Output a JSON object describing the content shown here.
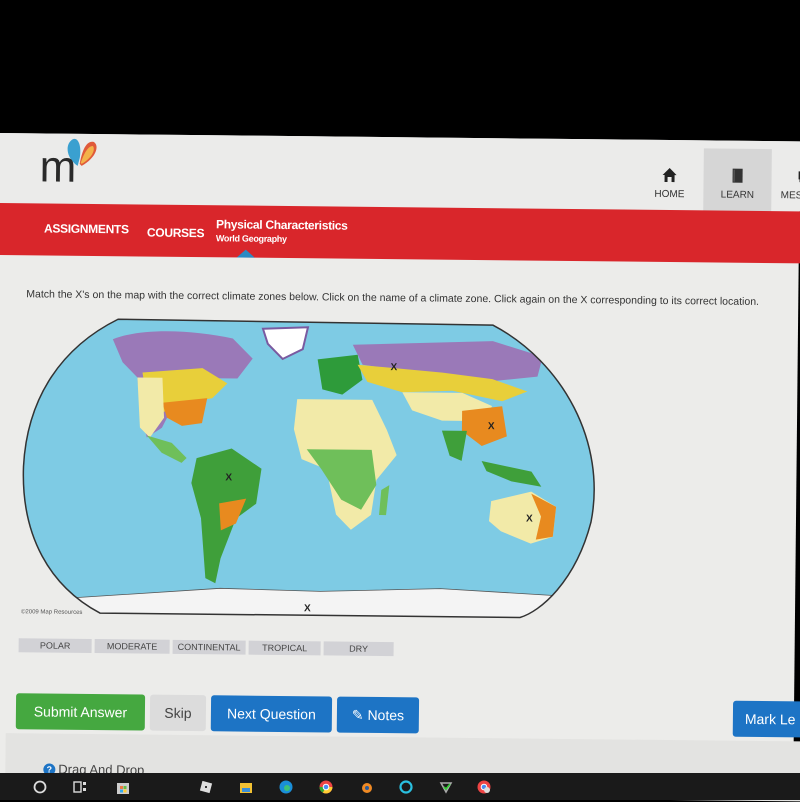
{
  "header": {
    "logo_letter": "m",
    "nav": [
      {
        "label": "HOME",
        "icon": "home-icon",
        "active": false
      },
      {
        "label": "LEARN",
        "icon": "book-icon",
        "active": true
      },
      {
        "label": "MESSAGE",
        "icon": "message-icon",
        "active": false
      }
    ]
  },
  "redbar": {
    "assignments": "ASSIGNMENTS",
    "courses": "COURSES",
    "course_title": "Physical Characteristics",
    "course_subtitle": "World Geography"
  },
  "question": {
    "instructions": "Match the X's on the map with the correct climate zones below. Click on the name of a climate zone. Click again on the X corresponding to its correct location.",
    "map_copyright": "©2009 Map Resources",
    "markers": [
      {
        "region": "Northern Russia",
        "label": "X"
      },
      {
        "region": "Eastern China",
        "label": "X"
      },
      {
        "region": "Amazon Basin",
        "label": "X"
      },
      {
        "region": "Australia interior",
        "label": "X"
      },
      {
        "region": "Antarctica",
        "label": "X"
      }
    ],
    "climate_zones": [
      "POLAR",
      "MODERATE",
      "CONTINENTAL",
      "TROPICAL",
      "DRY"
    ]
  },
  "actions": {
    "submit": "Submit Answer",
    "skip": "Skip",
    "next": "Next Question",
    "notes": "Notes",
    "mark": "Mark Le"
  },
  "footer": {
    "question_type": "Drag And Drop"
  },
  "colors": {
    "brand_red": "#d9262b",
    "submit_green": "#45a840",
    "action_blue": "#1d74c5",
    "ocean": "#7ecbe4",
    "polar": "#9a79b8",
    "continental": "#e8cf3a",
    "moderate": "#e88a1f",
    "tropical": "#3f9f3a",
    "dry": "#f2eaa8"
  }
}
